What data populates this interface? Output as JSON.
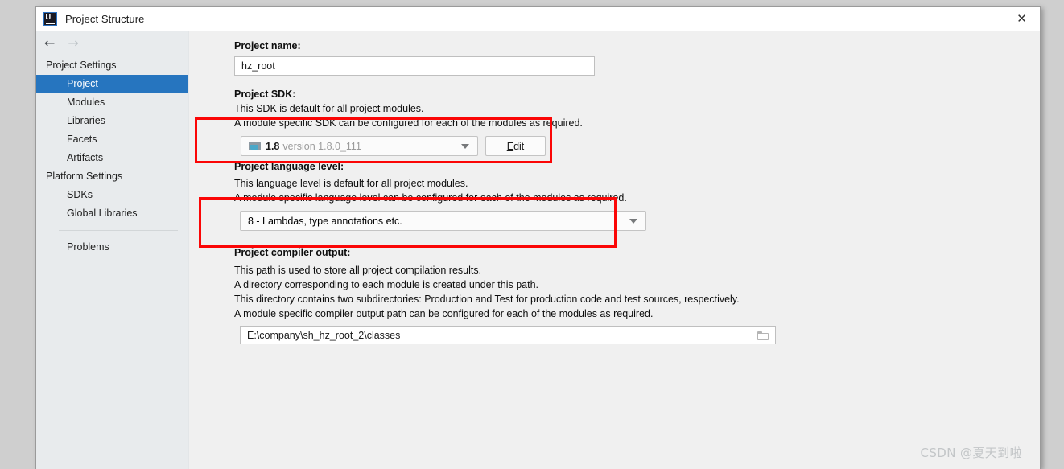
{
  "window": {
    "title": "Project Structure",
    "app_icon": "intellij-idea-icon",
    "close_label": "✕",
    "nav_back": "←",
    "nav_forward": "→"
  },
  "sidebar": {
    "groups": [
      {
        "label": "Project Settings",
        "items": [
          {
            "label": "Project",
            "selected": true
          },
          {
            "label": "Modules",
            "selected": false
          },
          {
            "label": "Libraries",
            "selected": false
          },
          {
            "label": "Facets",
            "selected": false
          },
          {
            "label": "Artifacts",
            "selected": false
          }
        ]
      },
      {
        "label": "Platform Settings",
        "items": [
          {
            "label": "SDKs",
            "selected": false
          },
          {
            "label": "Global Libraries",
            "selected": false
          }
        ]
      }
    ],
    "problems_label": "Problems"
  },
  "main": {
    "project_name": {
      "label": "Project name:",
      "value": "hz_root",
      "placeholder": ""
    },
    "project_sdk": {
      "label": "Project SDK:",
      "desc_line1": "This SDK is default for all project modules.",
      "desc_line2": "A module specific SDK can be configured for each of the modules as required.",
      "combo_strong": "1.8",
      "combo_dim": "version 1.8.0_111",
      "edit_button_mnemonic": "E",
      "edit_button_rest": "dit"
    },
    "language_level": {
      "label": "Project language level:",
      "desc_line1": "This language level is default for all project modules.",
      "desc_line2": "A module specific language level can be configured for each of the modules as required.",
      "value": "8 - Lambdas, type annotations etc."
    },
    "compiler_output": {
      "label": "Project compiler output:",
      "desc_line1": "This path is used to store all project compilation results.",
      "desc_line2": "A directory corresponding to each module is created under this path.",
      "desc_line3": "This directory contains two subdirectories: Production and Test for production code and test sources, respectively.",
      "desc_line4": "A module specific compiler output path can be configured for each of the modules as required.",
      "value": "E:\\company\\sh_hz_root_2\\classes",
      "browse_icon": "folder-icon"
    }
  },
  "annotations": {
    "highlight_color": "#fb0606",
    "boxes": [
      {
        "name": "sdk-highlight"
      },
      {
        "name": "language-level-highlight"
      }
    ]
  },
  "watermark": {
    "text": "CSDN @夏天到啦"
  },
  "colors": {
    "selection_blue": "#2675bf",
    "window_bg": "#f0f0f0",
    "sidebar_bg": "#e8ebed",
    "titlebar_bg": "#ffffff",
    "desktop_bg": "#cfcfcf"
  }
}
